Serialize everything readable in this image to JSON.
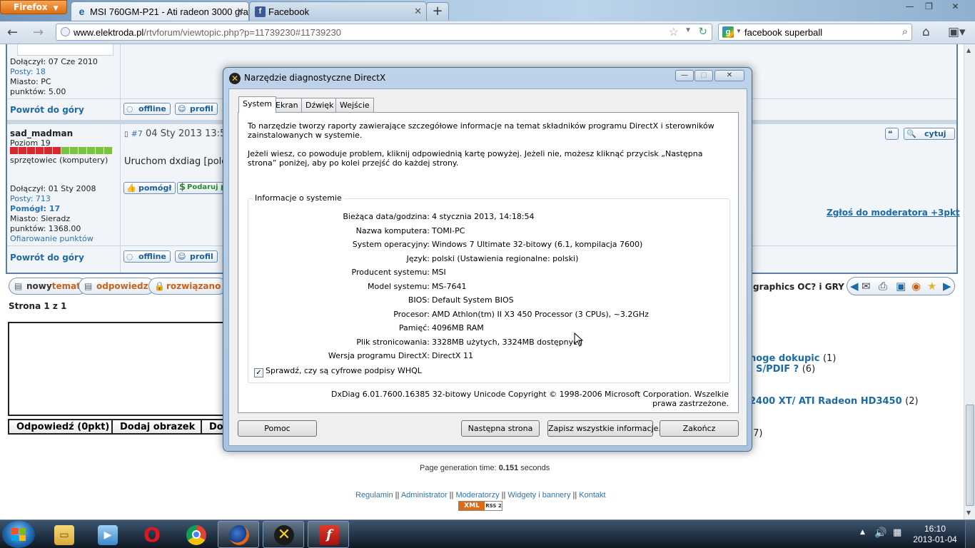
{
  "browser": {
    "menu_button": "Firefox",
    "tabs": [
      {
        "label": "MSI 760GM-P21 - Ati radeon 3000 gra...",
        "icon": "elektroda-icon"
      },
      {
        "label": "Facebook",
        "icon": "facebook-icon"
      }
    ],
    "url_domain": "www.elektroda.pl",
    "url_path": "/rtvforum/viewtopic.php?p=11739230#11739230",
    "search_value": "facebook superball"
  },
  "post_prev": {
    "joined": "Dołączył: 07 Cze 2010",
    "posts": "Posty: 18",
    "city": "Miasto: PC",
    "points": "punktów: 5.00",
    "back_to_top": "Powrót do góry",
    "offline": "offline",
    "profile": "profil"
  },
  "post7": {
    "author": "sad_madman",
    "level": "Poziom 19",
    "rank": "sprzętowiec (komputery)",
    "post_number": "#7",
    "date": "04 Sty 2013 13:5",
    "quote": "cytuj",
    "content": "Uruchom dxdiag [polec",
    "joined": "Dołączył: 01 Sty 2008",
    "posts": "Posty: 713",
    "helped": "Pomógł: 17",
    "city": "Miasto: Sieradz",
    "points": "punktów: 1368.00",
    "donate": "Ofiarowanie punktów",
    "helped_btn": "pomógł",
    "give_points": "Podaruj pk",
    "report": "Zgłoś do moderatora +3pkt",
    "back_to_top": "Powrót do góry",
    "offline": "offline",
    "profile": "profil"
  },
  "actions": {
    "new_topic_prefix": "nowy",
    "new_topic_suffix": "temat",
    "reply": "odpowiedz",
    "solved": "rozwiązano",
    "topic_title": "graphics OC? i GRY"
  },
  "page_info": "Strona 1 z 1",
  "form": {
    "reply_btn": "Odpowiedź (0pkt)",
    "add_image": "Dodaj obrazek",
    "third": "Dod"
  },
  "similar": [
    {
      "text": "noge dokupic",
      "count": "(1)"
    },
    {
      "text": "l S/PDIF ?",
      "count": "(6)"
    },
    {
      "text": "2400 XT/ ATI Radeon HD3450",
      "count": "(2)"
    },
    {
      "text": "",
      "count": "(7)"
    }
  ],
  "footer": {
    "gen_prefix": "Page generation time: ",
    "gen_value": "0.151",
    "gen_suffix": " seconds",
    "links": [
      "Regulamin",
      "Administrator",
      "Moderatorzy",
      "Widgety i bannery",
      "Kontakt"
    ],
    "separator": " || ",
    "xml": "XML",
    "rss": "RSS 2"
  },
  "dxdiag": {
    "title": "Narzędzie diagnostyczne DirectX",
    "tabs": [
      "System",
      "Ekran",
      "Dźwięk",
      "Wejście"
    ],
    "intro1": "To narzędzie tworzy raporty zawierające szczegółowe informacje na temat składników programu DirectX i sterowników zainstalowanych w systemie.",
    "intro2": "Jeżeli wiesz, co powoduje problem, kliknij odpowiednią kartę powyżej. Jeżeli nie, możesz kliknąć przycisk „Następna strona” poniżej, aby po kolei przejść do każdej strony.",
    "group_title": "Informacje o systemie",
    "info": [
      {
        "k": "Bieżąca data/godzina:",
        "v": "4 stycznia 2013, 14:18:54"
      },
      {
        "k": "Nazwa komputera:",
        "v": "TOMI-PC"
      },
      {
        "k": "System operacyjny:",
        "v": "Windows 7 Ultimate 32-bitowy (6.1, kompilacja 7600)"
      },
      {
        "k": "Język:",
        "v": "polski (Ustawienia regionalne: polski)"
      },
      {
        "k": "Producent systemu:",
        "v": "MSI"
      },
      {
        "k": "Model systemu:",
        "v": "MS-7641"
      },
      {
        "k": "BIOS:",
        "v": "Default System BIOS"
      },
      {
        "k": "Procesor:",
        "v": "AMD Athlon(tm) II X3 450 Processor (3 CPUs), ~3.2GHz"
      },
      {
        "k": "Pamięć:",
        "v": "4096MB RAM"
      },
      {
        "k": "Plik stronicowania:",
        "v": "3328MB użytych, 3324MB dostępnych"
      },
      {
        "k": "Wersja programu DirectX:",
        "v": "DirectX 11"
      }
    ],
    "whql": "Sprawdź, czy są cyfrowe podpisy WHQL",
    "whql_checked": true,
    "copyright": "DxDiag 6.01.7600.16385 32-bitowy Unicode  Copyright © 1998-2006 Microsoft Corporation. Wszelkie prawa zastrzeżone.",
    "buttons": {
      "help": "Pomoc",
      "next": "Następna strona",
      "save": "Zapisz wszystkie informacje...",
      "exit": "Zakończ"
    }
  },
  "taskbar": {
    "time": "16:10",
    "date": "2013-01-04",
    "items": [
      "explorer-icon",
      "media-player-icon",
      "opera-icon",
      "chrome-icon",
      "firefox-icon",
      "directx-icon",
      "flash-icon"
    ]
  }
}
